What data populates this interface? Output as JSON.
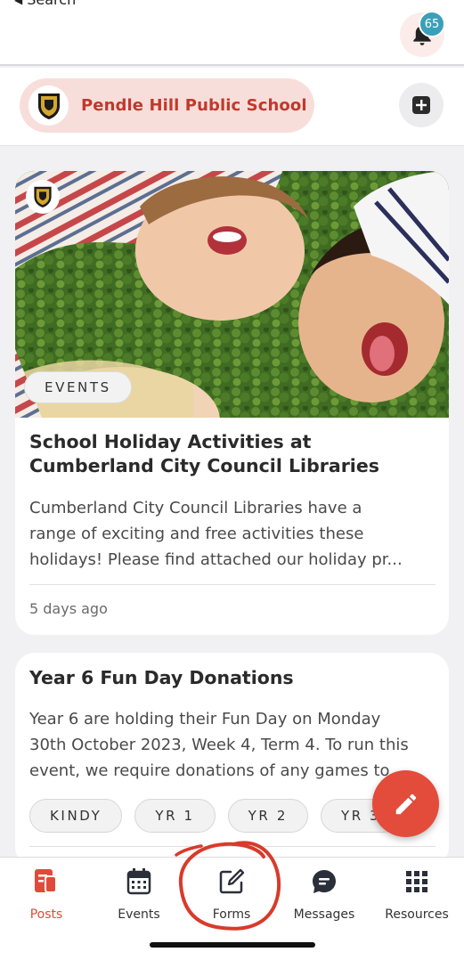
{
  "status_bar": {
    "back_label": "Search"
  },
  "header": {
    "notification_count": "65"
  },
  "school": {
    "name": "Pendle Hill Public School"
  },
  "posts": [
    {
      "category": "EVENTS",
      "title": "School Holiday Activities at Cumberland City Council Libraries",
      "body_lines": [
        "Cumberland City Council Libraries have a",
        "range of exciting and free activities these",
        "holidays!  Please find attached our holiday pr..."
      ],
      "time": "5 days ago"
    },
    {
      "title": "Year 6 Fun Day Donations",
      "body_lines": [
        "Year 6 are holding their Fun Day on Monday",
        "30th October 2023, Week 4, Term 4.   To run this",
        "event, we require donations of any games to"
      ],
      "tags": [
        "KINDY",
        "YR 1",
        "YR 2",
        "YR 3"
      ]
    }
  ],
  "nav": {
    "items": [
      {
        "label": "Posts",
        "icon": "posts-icon",
        "active": true
      },
      {
        "label": "Events",
        "icon": "calendar-icon",
        "active": false
      },
      {
        "label": "Forms",
        "icon": "edit-icon",
        "active": false
      },
      {
        "label": "Messages",
        "icon": "chat-icon",
        "active": false
      },
      {
        "label": "Resources",
        "icon": "grid-icon",
        "active": false
      }
    ]
  },
  "colors": {
    "accent": "#e04a3a",
    "school_pill": "#f8dedb",
    "badge": "#3aa0b8",
    "annotation": "#d93a2b"
  }
}
